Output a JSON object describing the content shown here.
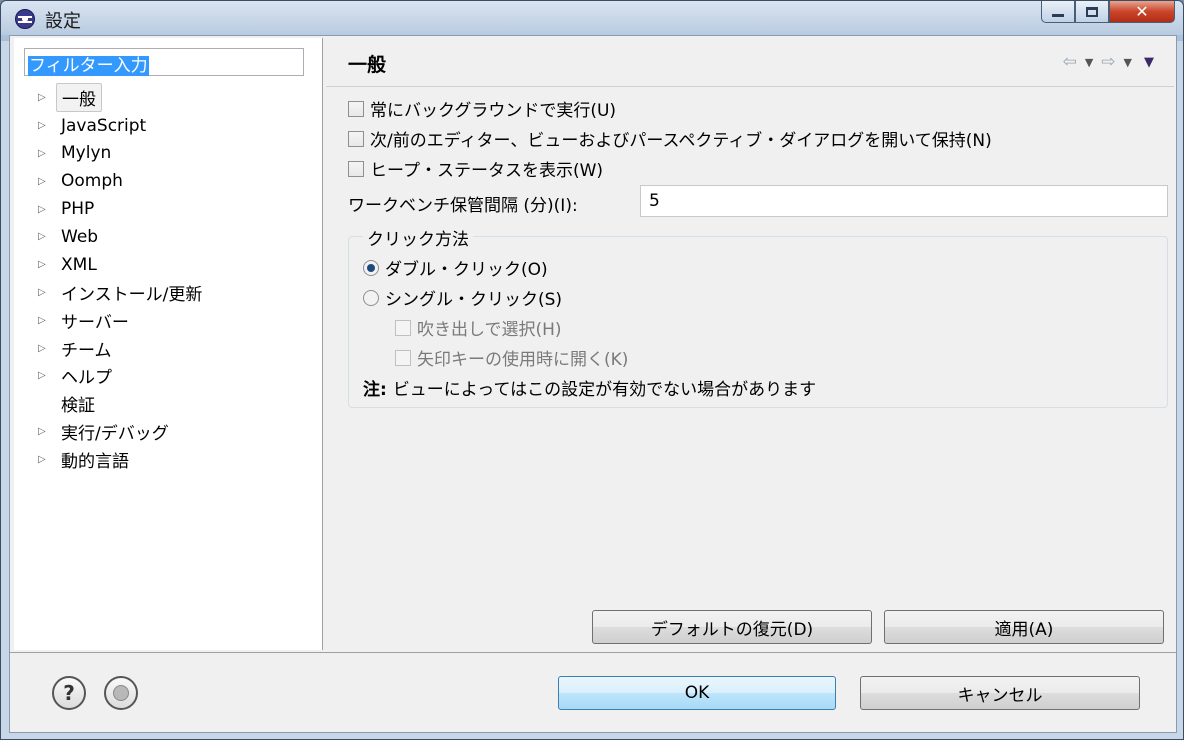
{
  "window": {
    "title": "設定"
  },
  "filter": {
    "value": "フィルター入力"
  },
  "tree": {
    "items": [
      {
        "label": "一般",
        "expandable": true
      },
      {
        "label": "JavaScript",
        "expandable": true
      },
      {
        "label": "Mylyn",
        "expandable": true
      },
      {
        "label": "Oomph",
        "expandable": true
      },
      {
        "label": "PHP",
        "expandable": true
      },
      {
        "label": "Web",
        "expandable": true
      },
      {
        "label": "XML",
        "expandable": true
      },
      {
        "label": "インストール/更新",
        "expandable": true
      },
      {
        "label": "サーバー",
        "expandable": true
      },
      {
        "label": "チーム",
        "expandable": true
      },
      {
        "label": "ヘルプ",
        "expandable": true
      },
      {
        "label": "検証",
        "expandable": false
      },
      {
        "label": "実行/デバッグ",
        "expandable": true
      },
      {
        "label": "動的言語",
        "expandable": true
      }
    ]
  },
  "page": {
    "title": "一般",
    "checkboxes": [
      {
        "label": "常にバックグラウンドで実行(U)"
      },
      {
        "label": "次/前のエディター、ビューおよびパースペクティブ・ダイアログを開いて保持(N)"
      },
      {
        "label": "ヒープ・ステータスを表示(W)"
      }
    ],
    "autosave": {
      "label": "ワークベンチ保管間隔 (分)(I):",
      "value": "5"
    },
    "click_group": {
      "title": "クリック方法",
      "double_click": "ダブル・クリック(O)",
      "single_click": "シングル・クリック(S)",
      "select_on_hover": "吹き出しで選択(H)",
      "open_arrow_keys": "矢印キーの使用時に開く(K)",
      "note_prefix": "注:",
      "note_text": "ビューによってはこの設定が有効でない場合があります"
    },
    "restore_defaults_label": "デフォルトの復元(D)",
    "apply_label": "適用(A)"
  },
  "footer": {
    "ok_label": "OK",
    "cancel_label": "キャンセル"
  }
}
